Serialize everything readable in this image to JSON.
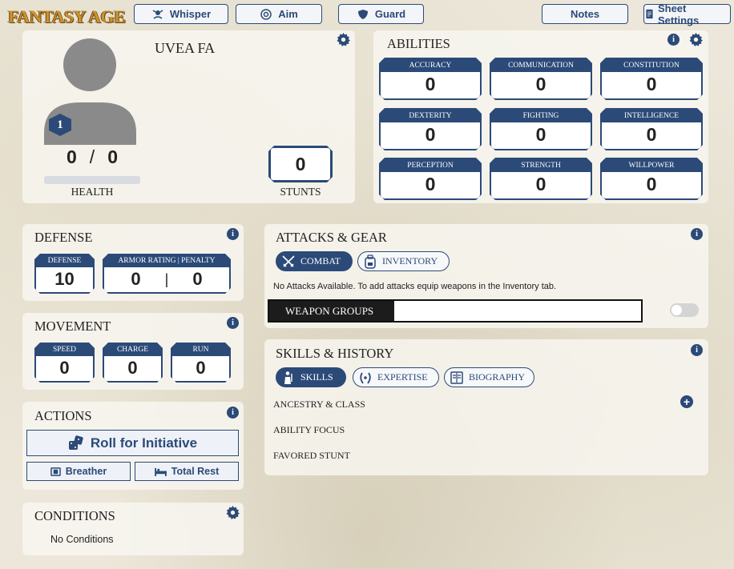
{
  "app": {
    "logo": "FANTASY AGE"
  },
  "topbar": {
    "whisper": "Whisper",
    "aim": "Aim",
    "guard": "Guard",
    "notes": "Notes",
    "settings": "Sheet Settings"
  },
  "character": {
    "name": "UVEA FA",
    "level": "1",
    "health_current": "0",
    "health_separator": "/",
    "health_max": "0",
    "health_label": "HEALTH",
    "stunts_value": "0",
    "stunts_label": "STUNTS"
  },
  "abilities": {
    "title": "ABILITIES",
    "items": [
      {
        "label": "ACCURACY",
        "value": "0"
      },
      {
        "label": "COMMUNICATION",
        "value": "0"
      },
      {
        "label": "CONSTITUTION",
        "value": "0"
      },
      {
        "label": "DEXTERITY",
        "value": "0"
      },
      {
        "label": "FIGHTING",
        "value": "0"
      },
      {
        "label": "INTELLIGENCE",
        "value": "0"
      },
      {
        "label": "PERCEPTION",
        "value": "0"
      },
      {
        "label": "STRENGTH",
        "value": "0"
      },
      {
        "label": "WILLPOWER",
        "value": "0"
      }
    ]
  },
  "defense": {
    "title": "DEFENSE",
    "defense_label": "DEFENSE",
    "defense_value": "10",
    "armor_label": "ARMOR RATING | PENALTY",
    "armor_value": "0",
    "armor_sep": "|",
    "penalty_value": "0"
  },
  "movement": {
    "title": "MOVEMENT",
    "items": [
      {
        "label": "SPEED",
        "value": "0"
      },
      {
        "label": "CHARGE",
        "value": "0"
      },
      {
        "label": "RUN",
        "value": "0"
      }
    ]
  },
  "actions": {
    "title": "ACTIONS",
    "initiative": "Roll for Initiative",
    "breather": "Breather",
    "total_rest": "Total Rest"
  },
  "conditions": {
    "title": "CONDITIONS",
    "empty": "No Conditions"
  },
  "attacks": {
    "title": "ATTACKS & GEAR",
    "tab_combat": "COMBAT",
    "tab_inventory": "INVENTORY",
    "message": "No Attacks Available. To add attacks equip weapons in the Inventory tab.",
    "weapon_groups": "WEAPON GROUPS"
  },
  "skills": {
    "title": "SKILLS & HISTORY",
    "tab_skills": "SKILLS",
    "tab_expertise": "EXPERTISE",
    "tab_biography": "BIOGRAPHY",
    "rows": [
      "ANCESTRY & CLASS",
      "ABILITY FOCUS",
      "FAVORED STUNT"
    ]
  },
  "colors": {
    "accent": "#2b4a78",
    "logo_gold": "#c9952e"
  }
}
